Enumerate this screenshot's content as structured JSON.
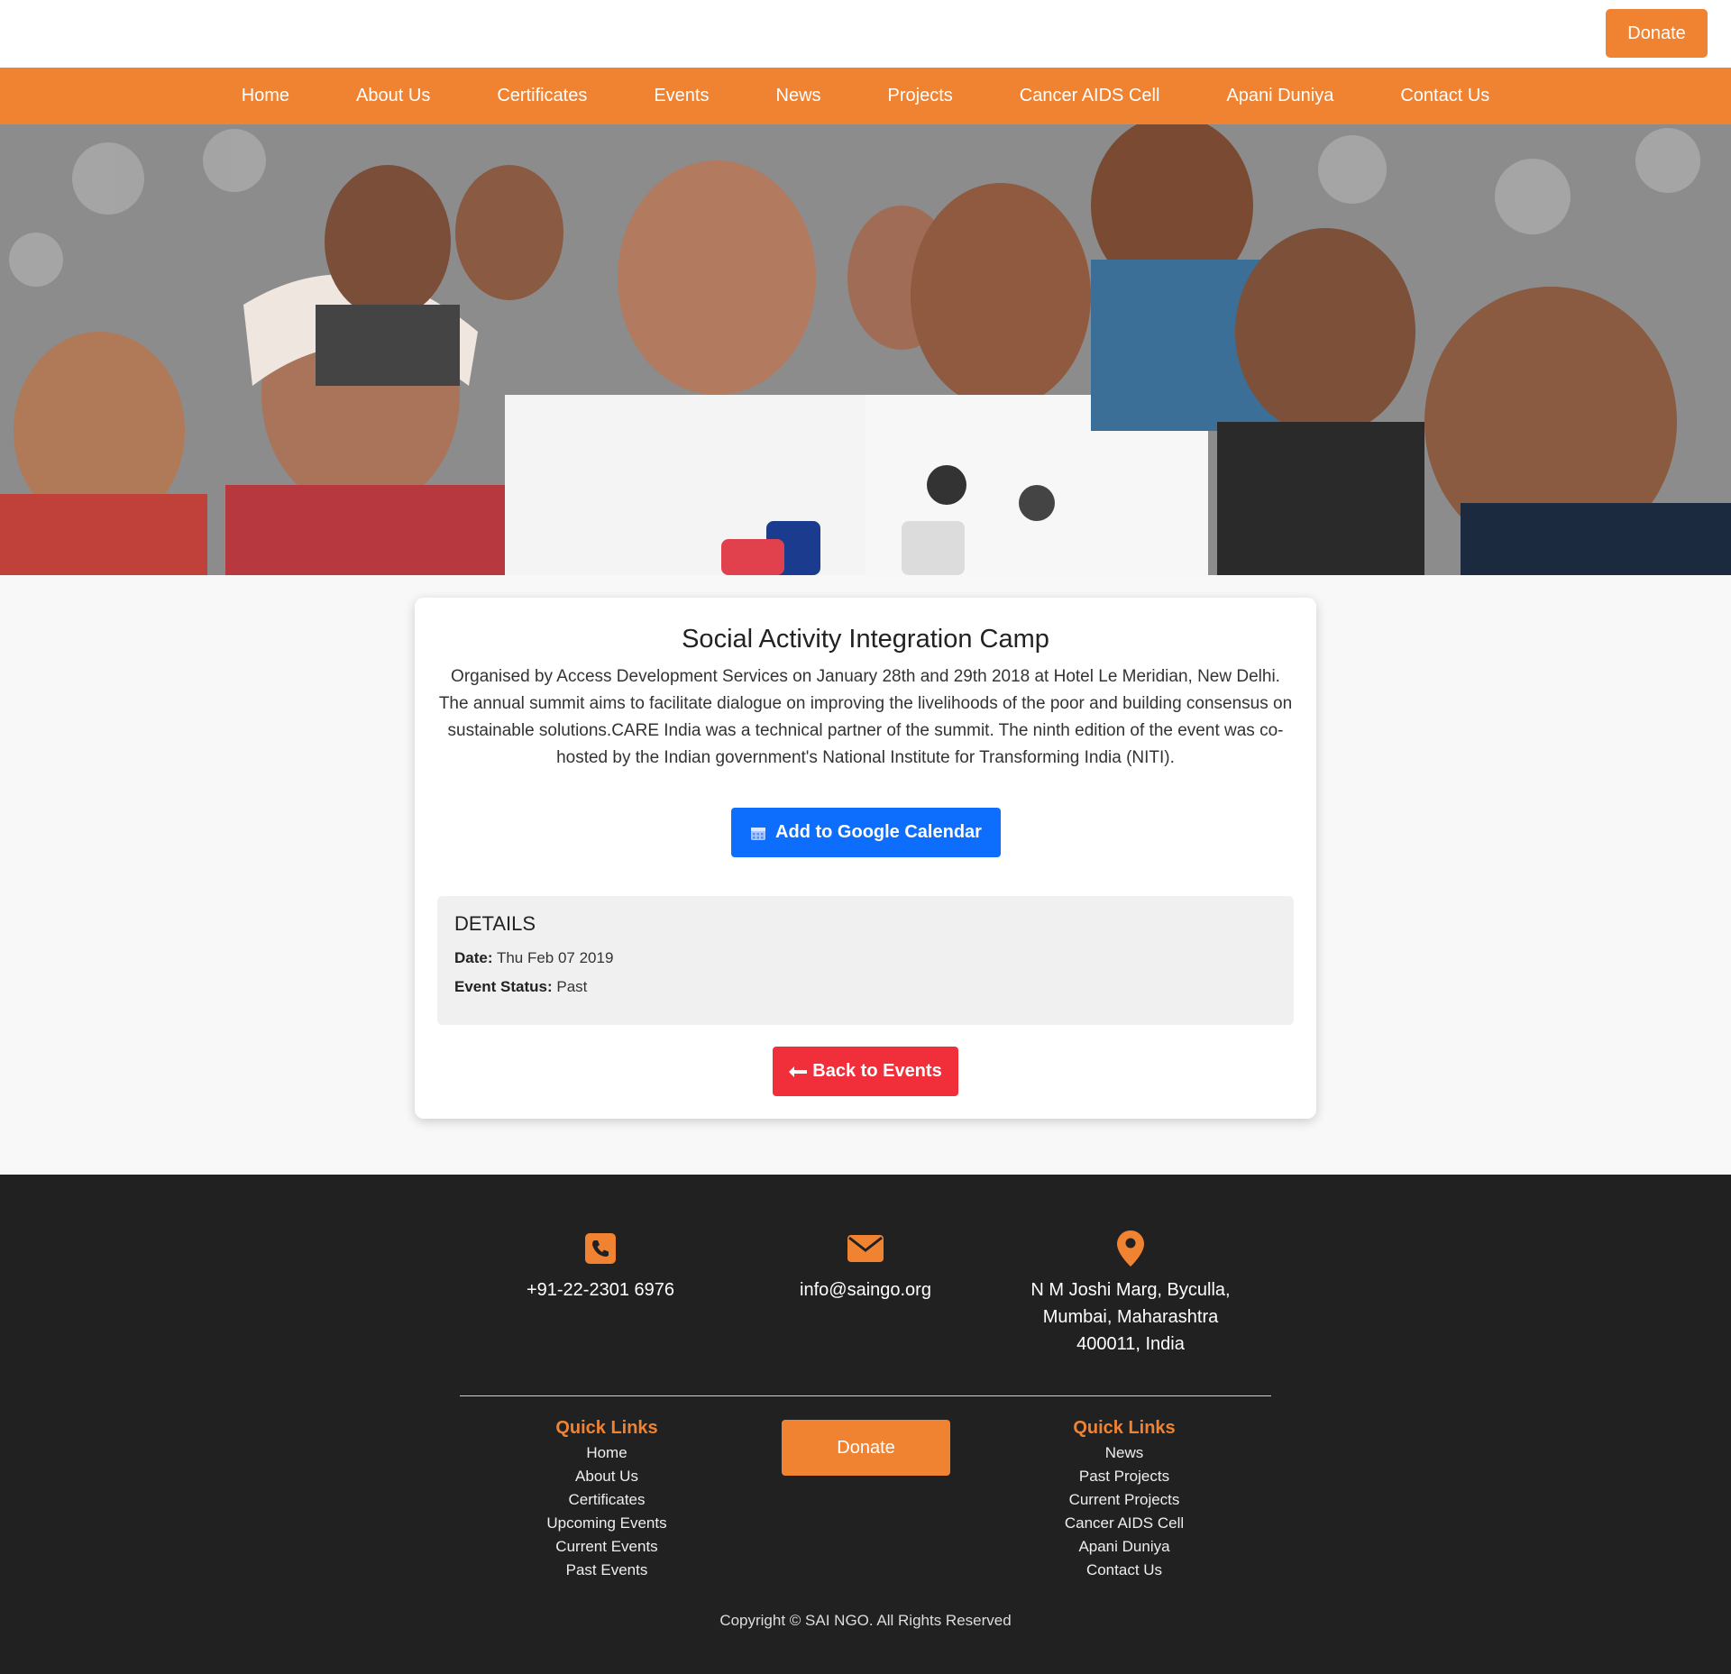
{
  "header": {
    "donate_label": "Donate"
  },
  "nav": {
    "items": [
      "Home",
      "About Us",
      "Certificates",
      "Events",
      "News",
      "Projects",
      "Cancer AIDS Cell",
      "Apani Duniya",
      "Contact Us"
    ]
  },
  "event": {
    "title": "Social Activity Integration Camp",
    "description": "Organised by Access Development Services on January 28th and 29th 2018 at Hotel Le Meridian, New Delhi. The annual summit aims to facilitate dialogue on improving the livelihoods of the poor and building consensus on sustainable solutions.CARE India was a technical partner of the summit. The ninth edition of the event was co-hosted by the Indian government's National Institute for Transforming India (NITI).",
    "gcal_label": "Add to Google Calendar",
    "details_heading": "DETAILS",
    "date_label": "Date:",
    "date_value": "Thu Feb 07 2019",
    "status_label": "Event Status:",
    "status_value": "Past",
    "back_label": "Back to Events"
  },
  "footer": {
    "phone": "+91-22-2301 6976",
    "email": "info@saingo.org",
    "address_line1": "N M Joshi Marg, Byculla,",
    "address_line2": "Mumbai, Maharashtra",
    "address_line3": "400011, India",
    "quick_links_left_title": "Quick Links",
    "quick_links_left": [
      "Home",
      "About Us",
      "Certificates",
      "Upcoming Events",
      "Current Events",
      "Past Events"
    ],
    "donate_label": "Donate",
    "quick_links_right_title": "Quick Links",
    "quick_links_right": [
      "News",
      "Past Projects",
      "Current Projects",
      "Cancer AIDS Cell",
      "Apani Duniya",
      "Contact Us"
    ],
    "copyright": "Copyright © SAI NGO. All Rights Reserved"
  },
  "colors": {
    "brand_orange": "#f08332",
    "primary_blue": "#0d6efd",
    "danger_red": "#f12f3a",
    "footer_bg": "#212121"
  },
  "icons": {
    "phone": "phone-icon",
    "email": "envelope-icon",
    "location": "map-pin-icon",
    "calendar": "calendar-icon",
    "back": "arrow-left-icon"
  }
}
